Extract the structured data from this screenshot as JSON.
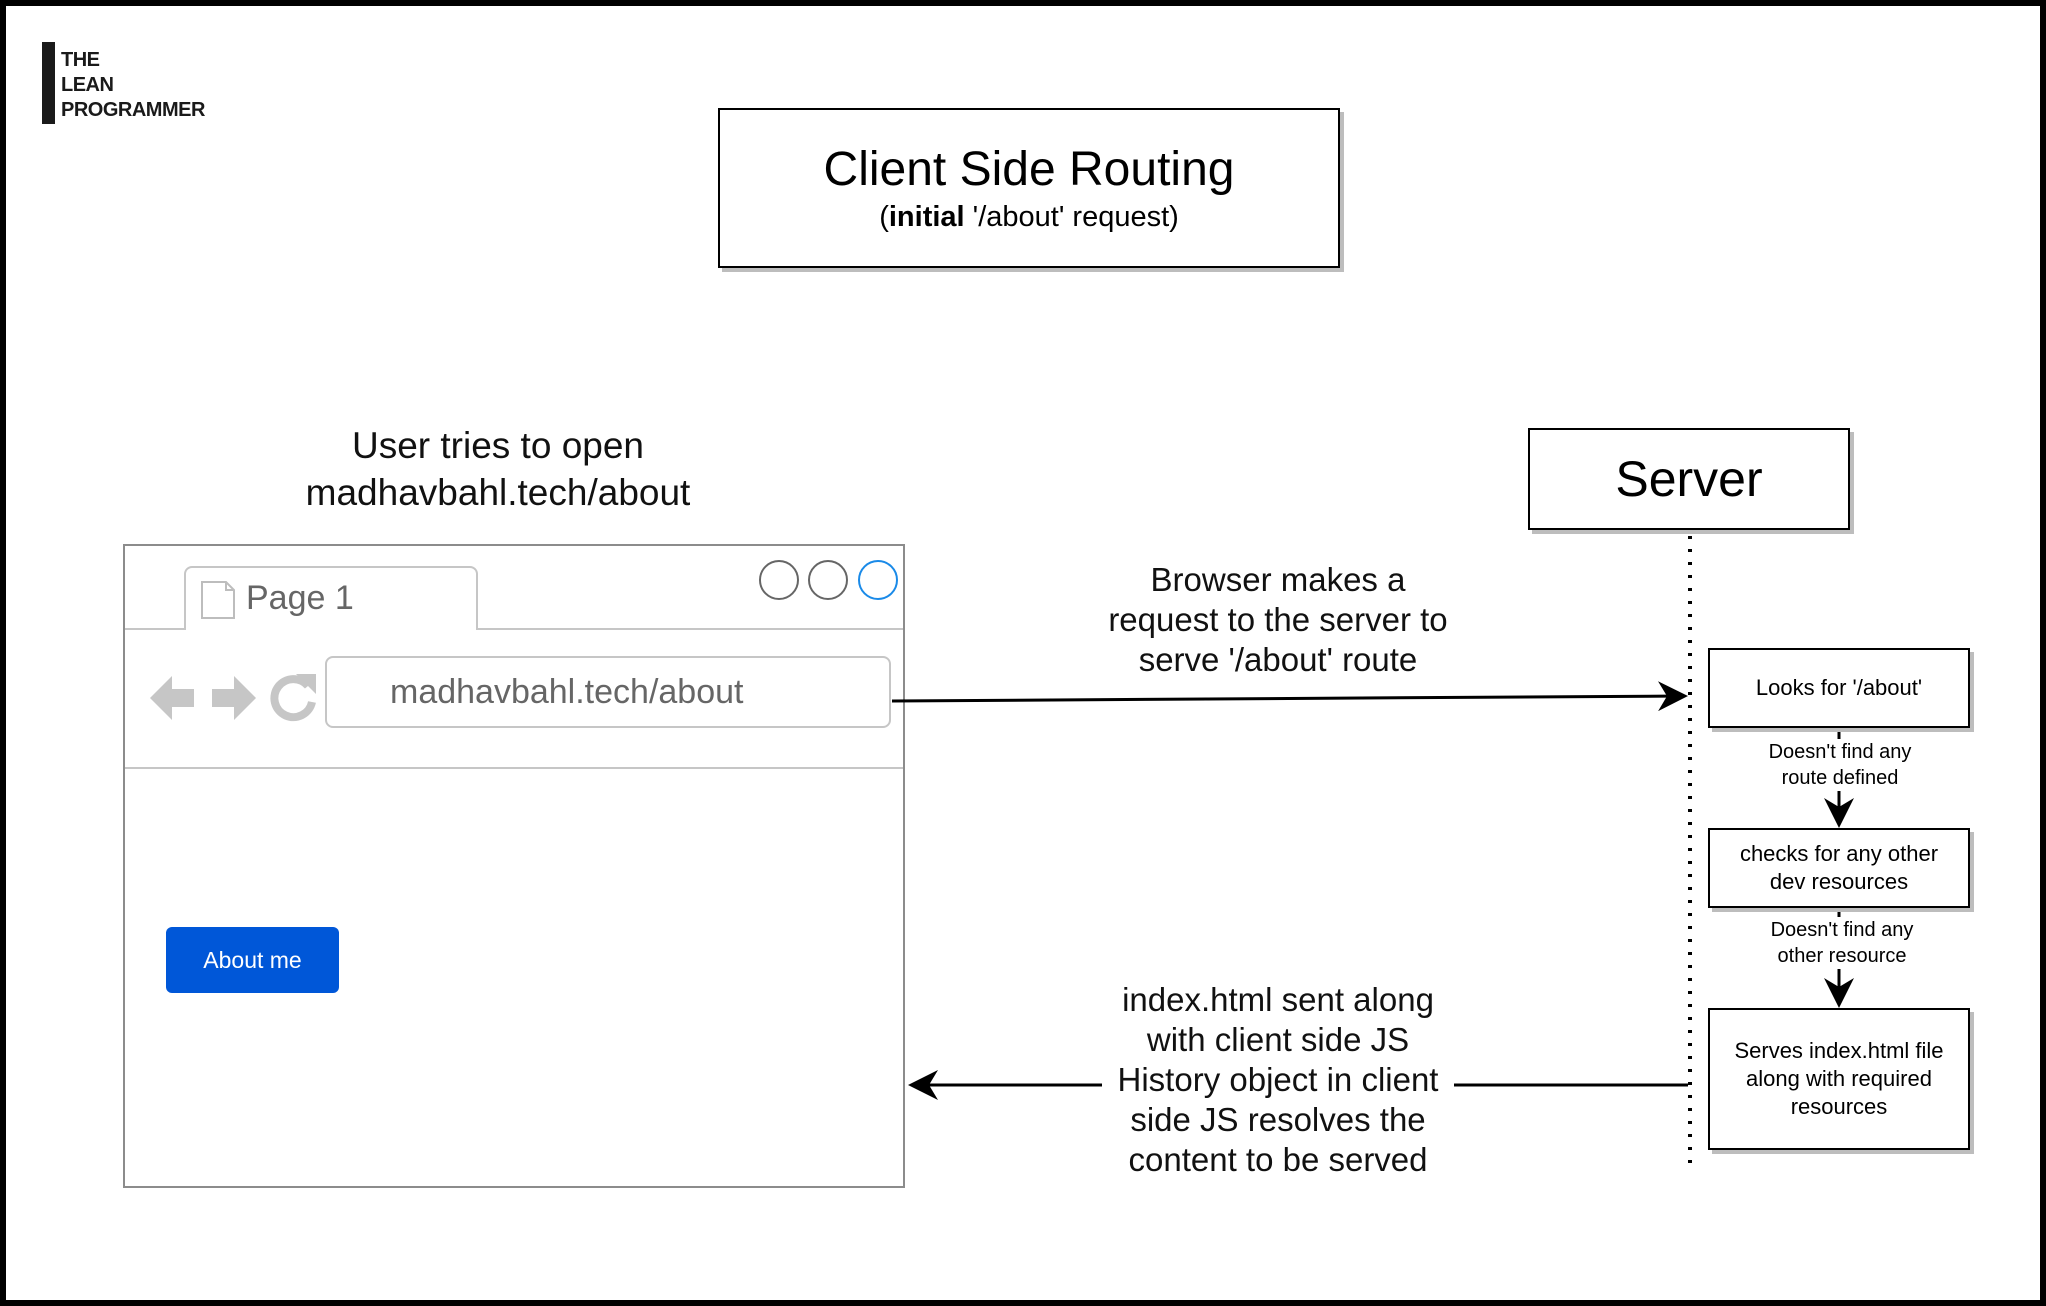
{
  "logo": {
    "lines": [
      "THE",
      "LEAN",
      "PROGRAMMER"
    ]
  },
  "title": {
    "main": "Client Side Routing",
    "sub_open": "(",
    "sub_bold": "initial",
    "sub_rest": " '/about' request)"
  },
  "user_label": {
    "line1": "User tries to open",
    "line2": "madhavbahl.tech/about"
  },
  "browser": {
    "tab_label": "Page 1",
    "url": "madhavbahl.tech/about",
    "button_label": "About me",
    "accent_color": "#0057d8"
  },
  "request_label": {
    "line1": "Browser makes a",
    "line2": "request to the server to",
    "line3": "serve '/about' route"
  },
  "response_label": {
    "line1": "index.html sent along",
    "line2": "with client side JS",
    "line3": "History object in client",
    "line4": "side JS resolves the",
    "line5": "content to be served"
  },
  "server": {
    "title": "Server",
    "steps": [
      {
        "line1": "Looks for '/about'"
      },
      {
        "line1": "checks for any other",
        "line2": "dev resources"
      },
      {
        "line1": "Serves index.html file",
        "line2": "along with required",
        "line3": "resources"
      }
    ],
    "transitions": [
      {
        "line1": "Doesn't find any",
        "line2": "route defined"
      },
      {
        "line1": "Doesn't find any",
        "line2": "other resource"
      }
    ]
  }
}
